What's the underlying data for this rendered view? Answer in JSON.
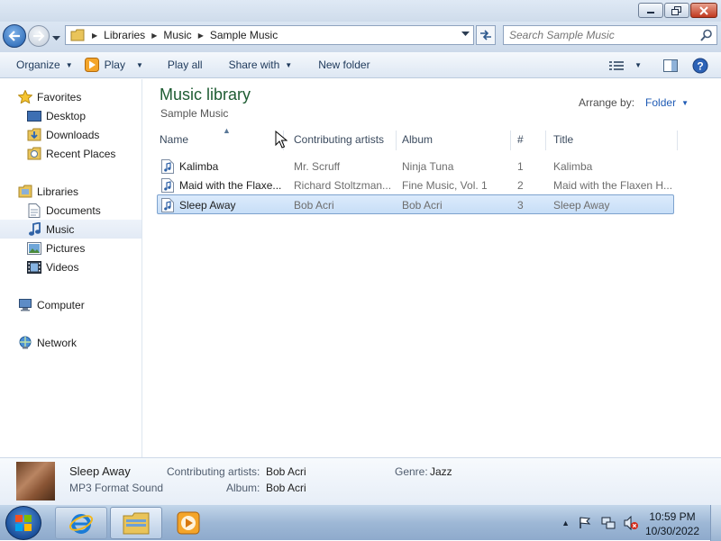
{
  "window": {
    "controls": {
      "minimize": "minimize",
      "maximize": "maximize",
      "close": "close"
    }
  },
  "address": {
    "breadcrumb": [
      "Libraries",
      "Music",
      "Sample Music"
    ]
  },
  "search": {
    "placeholder": "Search Sample Music"
  },
  "commands": {
    "organize": "Organize",
    "play": "Play",
    "play_all": "Play all",
    "share_with": "Share with",
    "new_folder": "New folder"
  },
  "nav": {
    "favorites": "Favorites",
    "desktop": "Desktop",
    "downloads": "Downloads",
    "recent_places": "Recent Places",
    "libraries": "Libraries",
    "documents": "Documents",
    "music": "Music",
    "pictures": "Pictures",
    "videos": "Videos",
    "computer": "Computer",
    "network": "Network"
  },
  "library": {
    "title": "Music library",
    "subtitle": "Sample Music",
    "arrange_label": "Arrange by:",
    "arrange_value": "Folder"
  },
  "columns": {
    "name": "Name",
    "artists": "Contributing artists",
    "album": "Album",
    "number": "#",
    "title": "Title"
  },
  "files": [
    {
      "name": "Kalimba",
      "artists": "Mr. Scruff",
      "album": "Ninja Tuna",
      "number": "1",
      "title": "Kalimba"
    },
    {
      "name": "Maid with the Flaxe...",
      "artists": "Richard Stoltzman...",
      "album": "Fine Music, Vol. 1",
      "number": "2",
      "title": "Maid with the Flaxen H..."
    },
    {
      "name": "Sleep Away",
      "artists": "Bob Acri",
      "album": "Bob Acri",
      "number": "3",
      "title": "Sleep Away"
    }
  ],
  "details": {
    "name": "Sleep Away",
    "type": "MP3 Format Sound",
    "artists_label": "Contributing artists:",
    "artists_value": "Bob Acri",
    "album_label": "Album:",
    "album_value": "Bob Acri",
    "genre_label": "Genre:",
    "genre_value": "Jazz"
  },
  "taskbar": {
    "time": "10:59 PM",
    "date": "10/30/2022"
  },
  "colors": {
    "accent": "#1f5bb5",
    "library_title": "#1e5c32",
    "selection": "#c7def7"
  }
}
